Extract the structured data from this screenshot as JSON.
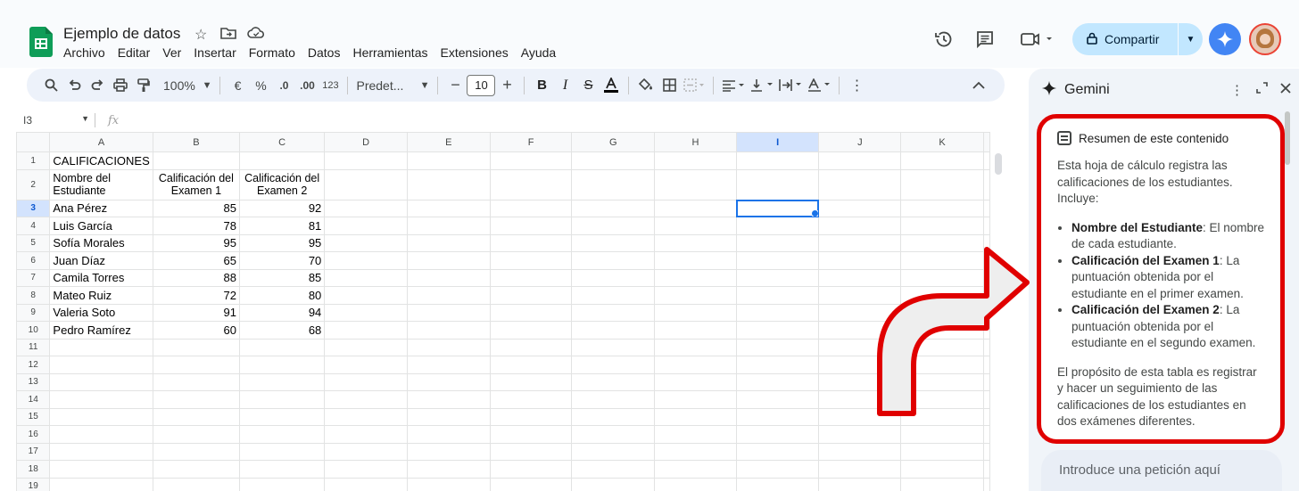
{
  "app": {
    "doc_title": "Ejemplo de datos",
    "menu": [
      "Archivo",
      "Editar",
      "Ver",
      "Insertar",
      "Formato",
      "Datos",
      "Herramientas",
      "Extensiones",
      "Ayuda"
    ],
    "share_label": "Compartir"
  },
  "toolbar": {
    "zoom": "100%",
    "currency": "€",
    "percent": "%",
    "dec_less": ".0",
    "dec_more": ".00",
    "format_123": "123",
    "font": "Predet...",
    "font_size": "10"
  },
  "formula_bar": {
    "cell_ref": "I3",
    "fx": "fx"
  },
  "sheet": {
    "columns": [
      "A",
      "B",
      "C",
      "D",
      "E",
      "F",
      "G",
      "H",
      "I",
      "J",
      "K"
    ],
    "selected_column": "I",
    "selected_row": "3",
    "rows": [
      {
        "n": "1",
        "a": "CALIFICACIONES",
        "b": "",
        "c": ""
      },
      {
        "n": "2",
        "a": "Nombre del Estudiante",
        "b": "Calificación del Examen 1",
        "c": "Calificación del Examen 2"
      },
      {
        "n": "3",
        "a": "Ana Pérez",
        "b": "85",
        "c": "92"
      },
      {
        "n": "4",
        "a": "Luis García",
        "b": "78",
        "c": "81"
      },
      {
        "n": "5",
        "a": "Sofía Morales",
        "b": "95",
        "c": "95"
      },
      {
        "n": "6",
        "a": "Juan Díaz",
        "b": "65",
        "c": "70"
      },
      {
        "n": "7",
        "a": "Camila Torres",
        "b": "88",
        "c": "85"
      },
      {
        "n": "8",
        "a": "Mateo Ruiz",
        "b": "72",
        "c": "80"
      },
      {
        "n": "9",
        "a": "Valeria Soto",
        "b": "91",
        "c": "94"
      },
      {
        "n": "10",
        "a": "Pedro Ramírez",
        "b": "60",
        "c": "68"
      },
      {
        "n": "11",
        "a": "",
        "b": "",
        "c": ""
      },
      {
        "n": "12",
        "a": "",
        "b": "",
        "c": ""
      },
      {
        "n": "13",
        "a": "",
        "b": "",
        "c": ""
      },
      {
        "n": "14",
        "a": "",
        "b": "",
        "c": ""
      },
      {
        "n": "15",
        "a": "",
        "b": "",
        "c": ""
      },
      {
        "n": "16",
        "a": "",
        "b": "",
        "c": ""
      },
      {
        "n": "17",
        "a": "",
        "b": "",
        "c": ""
      },
      {
        "n": "18",
        "a": "",
        "b": "",
        "c": ""
      },
      {
        "n": "19",
        "a": "",
        "b": "",
        "c": ""
      }
    ]
  },
  "gemini": {
    "title": "Gemini",
    "card_title": "Resumen de este contenido",
    "intro": "Esta hoja de cálculo registra las calificaciones de los estudiantes. Incluye:",
    "bullets": [
      {
        "term": "Nombre del Estudiante",
        "desc": ": El nombre de cada estudiante."
      },
      {
        "term": "Calificación del Examen 1",
        "desc": ": La puntuación obtenida por el estudiante en el primer examen."
      },
      {
        "term": "Calificación del Examen 2",
        "desc": ": La puntuación obtenida por el estudiante en el segundo examen."
      }
    ],
    "outro": "El propósito de esta tabla es registrar y hacer un seguimiento de las calificaciones de los estudiantes en dos exámenes diferentes.",
    "input_placeholder": "Introduce una petición aquí"
  },
  "colors": {
    "annotation_red": "#e00000",
    "selection_blue": "#1a73e8",
    "share_bg": "#c2e7ff",
    "sheets_green": "#0f9d58"
  }
}
